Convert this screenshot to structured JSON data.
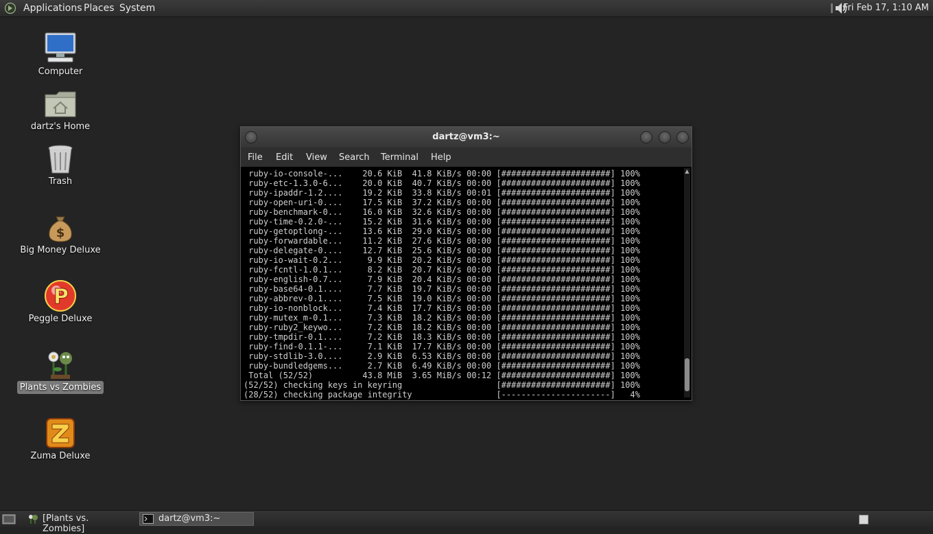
{
  "top_panel": {
    "menus": [
      "Applications",
      "Places",
      "System"
    ],
    "clock": "Fri Feb 17,  1:10 AM"
  },
  "desktop": {
    "icons": [
      {
        "label": "Computer",
        "icon": "computer-icon"
      },
      {
        "label": "dartz's Home",
        "icon": "home-folder-icon"
      },
      {
        "label": "Trash",
        "icon": "trash-icon"
      },
      {
        "label": "Big Money Deluxe",
        "icon": "money-bag-icon"
      },
      {
        "label": "Peggle Deluxe",
        "icon": "peggle-icon"
      },
      {
        "label": "Plants vs Zombies",
        "icon": "plants-vs-zombies-icon",
        "selected": true
      },
      {
        "label": "Zuma Deluxe",
        "icon": "zuma-icon"
      }
    ]
  },
  "terminal": {
    "title": "dartz@vm3:~",
    "menu": [
      "File",
      "Edit",
      "View",
      "Search",
      "Terminal",
      "Help"
    ],
    "lines": [
      " ruby-io-console-...    20.6 KiB  41.8 KiB/s 00:00 [######################] 100%",
      " ruby-etc-1.3.0-6...    20.0 KiB  40.7 KiB/s 00:00 [######################] 100%",
      " ruby-ipaddr-1.2....    19.2 KiB  33.8 KiB/s 00:01 [######################] 100%",
      " ruby-open-uri-0....    17.5 KiB  37.2 KiB/s 00:00 [######################] 100%",
      " ruby-benchmark-0...    16.0 KiB  32.6 KiB/s 00:00 [######################] 100%",
      " ruby-time-0.2.0-...    15.2 KiB  31.6 KiB/s 00:00 [######################] 100%",
      " ruby-getoptlong-...    13.6 KiB  29.0 KiB/s 00:00 [######################] 100%",
      " ruby-forwardable...    11.2 KiB  27.6 KiB/s 00:00 [######################] 100%",
      " ruby-delegate-0....    12.7 KiB  25.6 KiB/s 00:00 [######################] 100%",
      " ruby-io-wait-0.2...     9.9 KiB  20.2 KiB/s 00:00 [######################] 100%",
      " ruby-fcntl-1.0.1...     8.2 KiB  20.7 KiB/s 00:00 [######################] 100%",
      " ruby-english-0.7...     7.9 KiB  20.4 KiB/s 00:00 [######################] 100%",
      " ruby-base64-0.1....     7.7 KiB  19.7 KiB/s 00:00 [######################] 100%",
      " ruby-abbrev-0.1....     7.5 KiB  19.0 KiB/s 00:00 [######################] 100%",
      " ruby-io-nonblock...     7.4 KiB  17.7 KiB/s 00:00 [######################] 100%",
      " ruby-mutex_m-0.1...     7.3 KiB  18.2 KiB/s 00:00 [######################] 100%",
      " ruby-ruby2_keywo...     7.2 KiB  18.2 KiB/s 00:00 [######################] 100%",
      " ruby-tmpdir-0.1....     7.2 KiB  18.3 KiB/s 00:00 [######################] 100%",
      " ruby-find-0.1.1-...     7.1 KiB  17.7 KiB/s 00:00 [######################] 100%",
      " ruby-stdlib-3.0....     2.9 KiB  6.53 KiB/s 00:00 [######################] 100%",
      " ruby-bundledgems...     2.7 KiB  6.49 KiB/s 00:00 [######################] 100%",
      " Total (52/52)          43.8 MiB  3.65 MiB/s 00:12 [######################] 100%",
      "(52/52) checking keys in keyring                   [######################] 100%",
      "(28/52) checking package integrity                 [----------------------]   4%"
    ]
  },
  "taskbar": {
    "tasks": [
      {
        "label": "[Plants vs. Zombies]",
        "icon": "plants-vs-zombies-icon"
      },
      {
        "label": "dartz@vm3:~",
        "icon": "terminal-icon"
      }
    ]
  }
}
